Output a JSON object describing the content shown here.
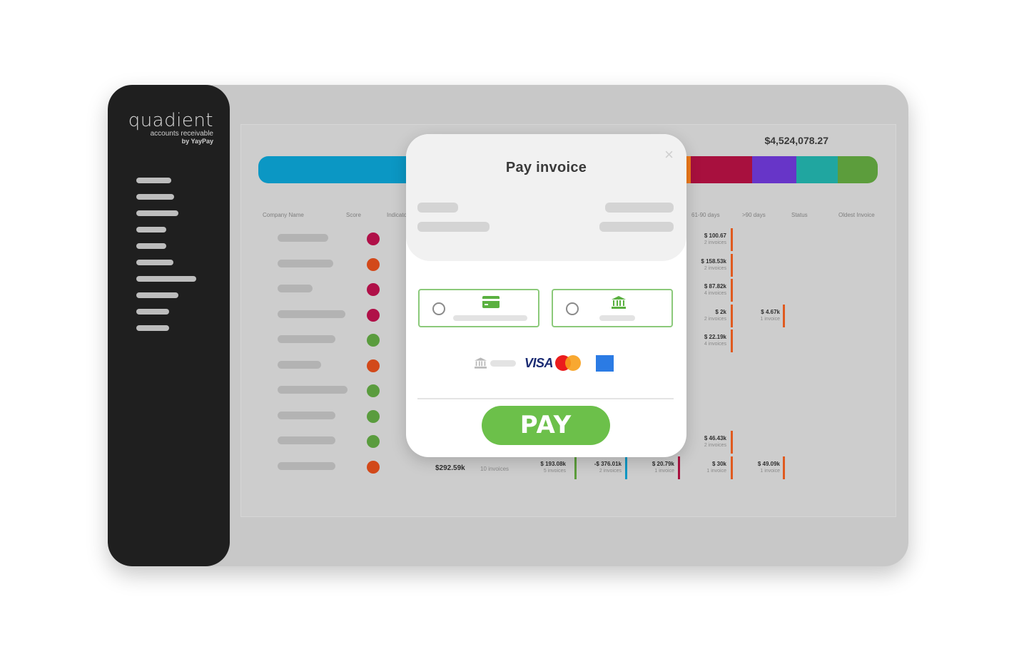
{
  "app": {
    "logo_brand": "quadient",
    "logo_sub": "accounts receivable",
    "logo_by": "by YayPay"
  },
  "dashboard": {
    "total": "$4,524,078.27",
    "aging_colors": [
      "#0b97c4",
      "#f07a1a",
      "#a8103e",
      "#6735c8",
      "#20a6a0",
      "#5c9d3c"
    ],
    "headers": [
      "Company Name",
      "Score",
      "Indicator",
      "61-90 days",
      ">90 days",
      "Status",
      "Oldest Invoice"
    ],
    "score_colors": [
      "#b01048",
      "#d2491a",
      "#b01048",
      "#b01048",
      "#5a9c3e",
      "#d2491a",
      "#5a9c3e",
      "#5a9c3e",
      "#5a9c3e",
      "#d2491a"
    ],
    "col_61_90": [
      {
        "amount": "$ 100.67",
        "invoices": "2 invoices"
      },
      {
        "amount": "$ 158.53k",
        "invoices": "2 invoices"
      },
      {
        "amount": "$ 87.82k",
        "invoices": "4 invoices"
      },
      {
        "amount": "$ 2k",
        "invoices": "2 invoices"
      },
      {
        "amount": "$ 22.19k",
        "invoices": "4 invoices"
      },
      {
        "amount": "$ 46.43k",
        "invoices": "2 invoices"
      },
      {
        "amount": "$ 30k",
        "invoices": "1 invoice"
      }
    ],
    "col_90plus": [
      {
        "amount": "$ 4.67k",
        "invoices": "1 invoice"
      },
      {
        "amount": "$ 49.09k",
        "invoices": "1 invoice"
      }
    ],
    "last_row": {
      "total": "$292.59k",
      "invoices": "10 invoices",
      "b1_amount": "$ 193.08k",
      "b1_invoices": "5 invoices",
      "b2_amount": "-$ 376.01k",
      "b2_invoices": "2 invoices",
      "b3_amount": "$ 20.79k",
      "b3_invoices": "1 invoice"
    }
  },
  "modal": {
    "title": "Pay invoice",
    "close_icon": "×",
    "card_icon": "credit-card-icon",
    "bank_icon": "bank-icon",
    "visa": "VISA",
    "pay_label": "PAY",
    "accent": "#6cc04a"
  }
}
